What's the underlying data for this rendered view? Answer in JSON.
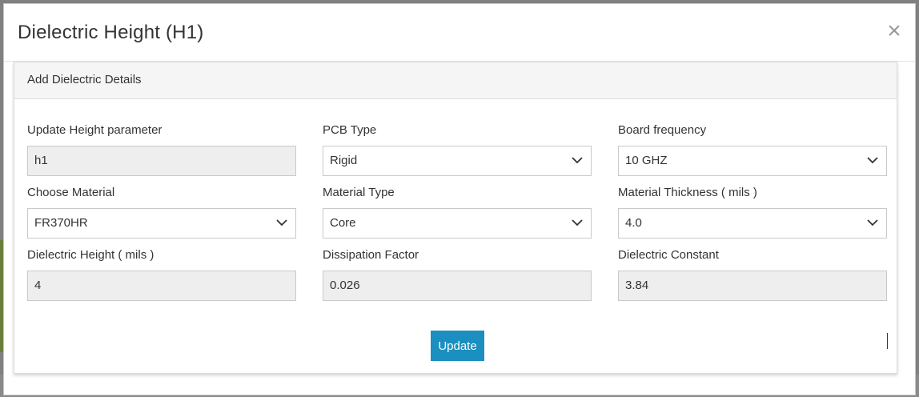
{
  "modal": {
    "title": "Dielectric Height (H1)",
    "close_glyph": "×"
  },
  "panel": {
    "heading": "Add Dielectric Details"
  },
  "fields": {
    "height_param": {
      "label": "Update Height parameter",
      "value": "h1"
    },
    "pcb_type": {
      "label": "PCB Type",
      "value": "Rigid"
    },
    "board_frequency": {
      "label": "Board frequency",
      "value": "10 GHZ"
    },
    "material": {
      "label": "Choose Material",
      "value": "FR370HR"
    },
    "material_type": {
      "label": "Material Type",
      "value": "Core"
    },
    "material_thickness": {
      "label": "Material Thickness ( mils )",
      "value": "4.0"
    },
    "dielectric_height": {
      "label": "Dielectric Height ( mils )",
      "value": "4"
    },
    "dissipation_factor": {
      "label": "Dissipation Factor",
      "value": "0.026"
    },
    "dielectric_constant": {
      "label": "Dielectric Constant",
      "value": "3.84"
    }
  },
  "actions": {
    "update_label": "Update"
  },
  "colors": {
    "accent": "#1a8fc0",
    "readonly_bg": "#eeeeee"
  }
}
